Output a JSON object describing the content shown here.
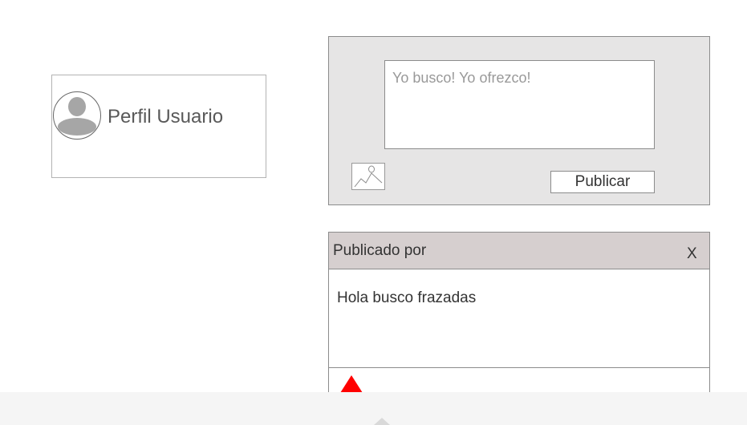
{
  "profile": {
    "name": "Perfil Usuario",
    "avatar_icon": "user-avatar-icon"
  },
  "composer": {
    "placeholder": "Yo busco! Yo ofrezco!",
    "image_icon": "image-icon",
    "publish_label": "Publicar"
  },
  "post": {
    "author_label": "Publicado por",
    "close_label": "X",
    "body": "Hola busco frazadas",
    "upvote_icon": "upvote-triangle-icon",
    "upvote_color": "#ff0000"
  },
  "footer": {
    "scroll_icon": "chevron-up-icon"
  },
  "colors": {
    "composer_bg": "#e6e5e5",
    "post_header_bg": "#d6cfcf",
    "bottom_bar_bg": "#f5f5f5"
  }
}
